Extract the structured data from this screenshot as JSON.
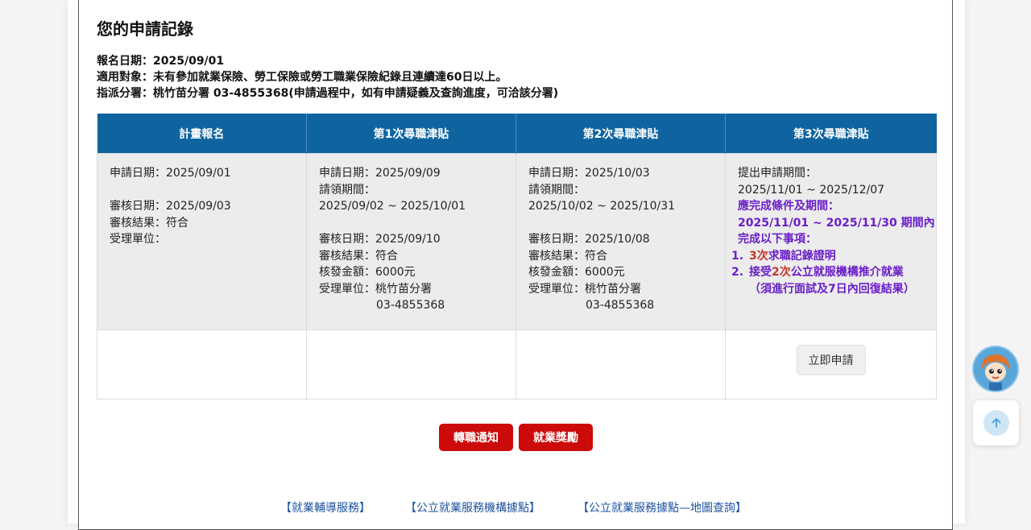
{
  "heading": "您的申請記錄",
  "meta": {
    "reg_date": "報名日期：2025/09/01",
    "target": "適用對象：未有參加就業保險、勞工保險或勞工職業保險紀錄且連續達60日以上。",
    "office": "指派分署：桃竹苗分署 03-4855368(申請過程中，如有申請疑義及查詢進度，可洽該分署)"
  },
  "table": {
    "headers": [
      "計畫報名",
      "第1次尋職津貼",
      "第2次尋職津貼",
      "第3次尋職津貼"
    ],
    "col1": {
      "apply_date": "申請日期：2025/09/01",
      "review_date": "審核日期：2025/09/03",
      "review_result": "審核結果：符合",
      "unit": "受理單位："
    },
    "col2": {
      "apply_date": "申請日期：2025/09/09",
      "period_label": "請領期間：",
      "period": "2025/09/02 ~ 2025/10/01",
      "review_date": "審核日期：2025/09/10",
      "review_result": "審核結果：符合",
      "amount": "核發金額：6000元",
      "unit": "受理單位：桃竹苗分署",
      "phone": "03-4855368"
    },
    "col3": {
      "apply_date": "申請日期：2025/10/03",
      "period_label": "請領期間：",
      "period": "2025/10/02 ~ 2025/10/31",
      "review_date": "審核日期：2025/10/08",
      "review_result": "審核結果：符合",
      "amount": "核發金額：6000元",
      "unit": "受理單位：桃竹苗分署",
      "phone": "03-4855368"
    },
    "col4": {
      "submit_label": "提出申請期間：",
      "submit_period": "2025/11/01 ~ 2025/12/07",
      "cond_label": "應完成條件及期間：",
      "cond_period": "2025/11/01 ~ 2025/11/30 期間內",
      "cond_tail": "完成以下事項：",
      "item1_num": "1.",
      "item1_count": "3次",
      "item1_text": "求職記錄證明",
      "item2_num": "2.",
      "item2_pre": "接受",
      "item2_count": "2次",
      "item2_text": "公立就服機構推介就業",
      "item2_note": "（須進行面試及7日內回復結果）",
      "apply_button": "立即申請"
    }
  },
  "buttons": {
    "transfer": "轉職通知",
    "reward": "就業獎勵"
  },
  "links": [
    "【就業輔導服務】",
    "【公立就業服務機構據點】",
    "【公立就業服務據點—地圖查詢】"
  ],
  "colors": {
    "header_blue": "#0f64a0",
    "button_red": "#cc0a0a",
    "highlight_purple": "#6a1fc8",
    "highlight_red": "#c0392b"
  }
}
